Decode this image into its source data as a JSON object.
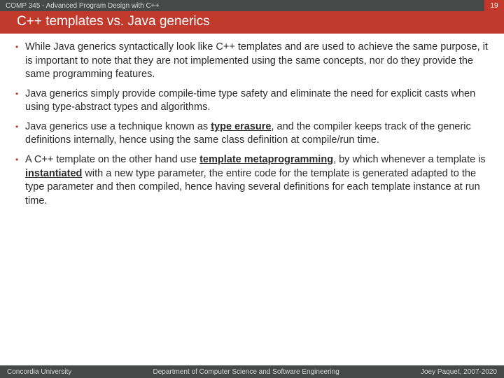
{
  "header": {
    "course": "COMP 345 - Advanced Program Design with C++",
    "page_number": "19"
  },
  "title": "C++ templates vs. Java generics",
  "bullets": [
    {
      "html": "While Java generics syntactically look like C++ templates and are used to achieve the same purpose, it is important to note that they are not implemented using the same concepts, nor do they provide the same programming features."
    },
    {
      "html": "Java generics simply provide compile-time type safety and eliminate the need for explicit casts when using type-abstract types and algorithms."
    },
    {
      "html": "Java generics use a technique known as <b class=\"u\">type erasure</b>, and the compiler keeps track of the generic definitions internally, hence using the same class definition at compile/run time."
    },
    {
      "html": "A C++ template on the other hand use <b class=\"u\">template metaprogramming</b>, by which whenever a template is <b class=\"u\">instantiated</b> with a new type parameter, the entire code for the template is generated adapted to the type parameter and then compiled, hence having several definitions for each template instance at run time."
    }
  ],
  "footer": {
    "left": "Concordia University",
    "center": "Department of Computer Science and Software Engineering",
    "right": "Joey Paquet, 2007-2020"
  }
}
